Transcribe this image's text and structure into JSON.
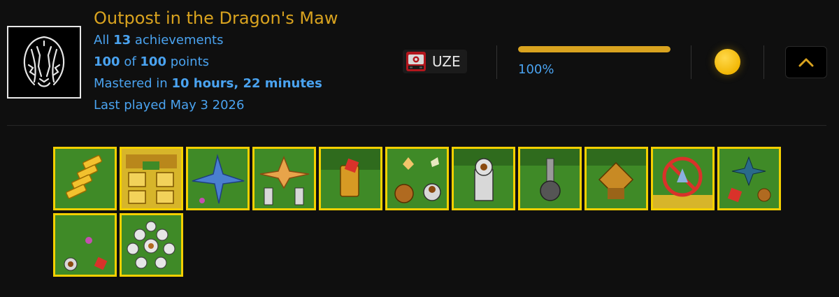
{
  "game": {
    "title": "Outpost in the Dragon's Maw",
    "cover_icon": "dragon-skull-icon"
  },
  "stats": {
    "achievements_prefix": "All",
    "achievements_count": "13",
    "achievements_suffix": "achievements",
    "points_earned": "100",
    "points_of": "of",
    "points_total": "100",
    "points_suffix": "points",
    "mastered_prefix": "Mastered in",
    "mastered_time": "10 hours, 22 minutes",
    "last_played": "Last played May 3 2026"
  },
  "console": {
    "icon": "uzebox-console-icon",
    "label": "UZE"
  },
  "progress": {
    "fraction": 1.0,
    "label": "100%"
  },
  "medal": {
    "icon": "gold-medal-icon"
  },
  "collapse_button": {
    "icon": "chevron-up-icon"
  },
  "colors": {
    "accent_gold": "#d9a31f",
    "link_blue": "#4aa3f0",
    "badge_border": "#f4d000",
    "background": "#0f0f0f"
  },
  "badges": [
    {
      "icon": "gold-bars-badge-icon"
    },
    {
      "icon": "golden-fortress-badge-icon"
    },
    {
      "icon": "blue-dragon-badge-icon"
    },
    {
      "icon": "orange-dragon-cannons-badge-icon"
    },
    {
      "icon": "treasure-crystal-badge-icon"
    },
    {
      "icon": "dragon-towers-badge-icon"
    },
    {
      "icon": "stone-tower-badge-icon"
    },
    {
      "icon": "cannon-turret-badge-icon"
    },
    {
      "icon": "wooden-hut-badge-icon"
    },
    {
      "icon": "no-dragon-badge-icon"
    },
    {
      "icon": "small-dragon-field-badge-icon"
    },
    {
      "icon": "pink-sprite-field-badge-icon"
    },
    {
      "icon": "stone-army-badge-icon"
    }
  ]
}
